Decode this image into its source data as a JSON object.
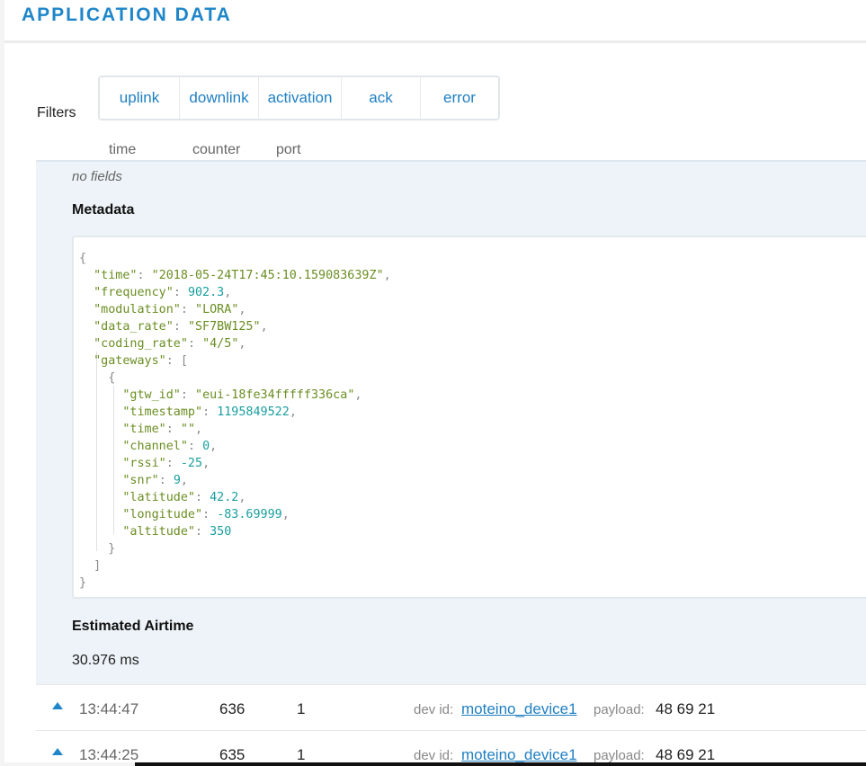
{
  "header": {
    "title": "APPLICATION DATA"
  },
  "filters": {
    "label": "Filters",
    "buttons": [
      "uplink",
      "downlink",
      "activation",
      "ack",
      "error"
    ]
  },
  "columns": {
    "time": "time",
    "counter": "counter",
    "port": "port"
  },
  "detail": {
    "no_fields": "no fields",
    "metadata_title": "Metadata",
    "airtime_title": "Estimated Airtime",
    "airtime_value": "30.976 ms",
    "metadata": {
      "time": "2018-05-24T17:45:10.159083639Z",
      "frequency": "902.3",
      "modulation": "LORA",
      "data_rate": "SF7BW125",
      "coding_rate": "4/5",
      "gateway": {
        "gtw_id": "eui-18fe34fffff336ca",
        "timestamp": "1195849522",
        "time": "",
        "channel": "0",
        "rssi": "-25",
        "snr": "9",
        "latitude": "42.2",
        "longitude": "-83.69999",
        "altitude": "350"
      }
    }
  },
  "rows": [
    {
      "time": "13:44:47",
      "counter": "636",
      "port": "1",
      "devid_label": "dev id:",
      "devid": "moteino_device1",
      "payload_label": "payload:",
      "payload": "48 69 21"
    },
    {
      "time": "13:44:25",
      "counter": "635",
      "port": "1",
      "devid_label": "dev id:",
      "devid": "moteino_device1",
      "payload_label": "payload:",
      "payload": "48 69 21"
    }
  ],
  "colors": {
    "accent": "#1f86c9",
    "json_key": "#6b8e23",
    "json_number": "#1a9e9e",
    "detail_bg": "#edf3f8"
  }
}
